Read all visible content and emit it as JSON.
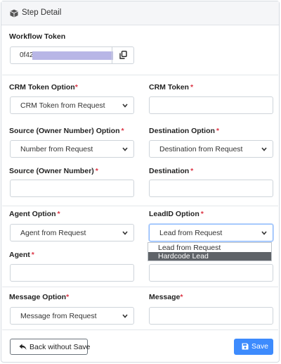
{
  "header": {
    "title": "Step Detail",
    "icon": "cube-icon"
  },
  "workflow_token": {
    "label": "Workflow Token",
    "value_prefix": "0f42"
  },
  "crm_token_option": {
    "label": "CRM Token Option",
    "required": "*",
    "selected": "CRM Token from Request"
  },
  "crm_token": {
    "label": "CRM Token",
    "required": "*",
    "value": ""
  },
  "source_option": {
    "label": "Source (Owner Number) Option",
    "required": "*",
    "selected": "Number from Request"
  },
  "destination_option": {
    "label": "Destination Option",
    "required": "*",
    "selected": "Destination from Request"
  },
  "source_number": {
    "label": "Source (Owner Number)",
    "required": "*",
    "value": ""
  },
  "destination": {
    "label": "Destination",
    "required": "*",
    "value": ""
  },
  "agent_option": {
    "label": "Agent Option",
    "required": "*",
    "selected": "Agent from Request"
  },
  "leadid_option": {
    "label": "LeadID Option",
    "required": "*",
    "selected": "Lead from Request",
    "options": [
      "Lead from Request",
      "Hardcode Lead"
    ],
    "highlighted": "Hardcode Lead"
  },
  "agent": {
    "label": "Agent",
    "required": "*",
    "value": ""
  },
  "message_option": {
    "label": "Message Option",
    "required": "*",
    "selected": "Message from Request"
  },
  "message": {
    "label": "Message",
    "required": "*",
    "value": ""
  },
  "buttons": {
    "back": "Back without Save",
    "save": "Save"
  },
  "colors": {
    "primary": "#3d8bfd",
    "required": "#dc3545",
    "highlight": "#5f6368"
  }
}
